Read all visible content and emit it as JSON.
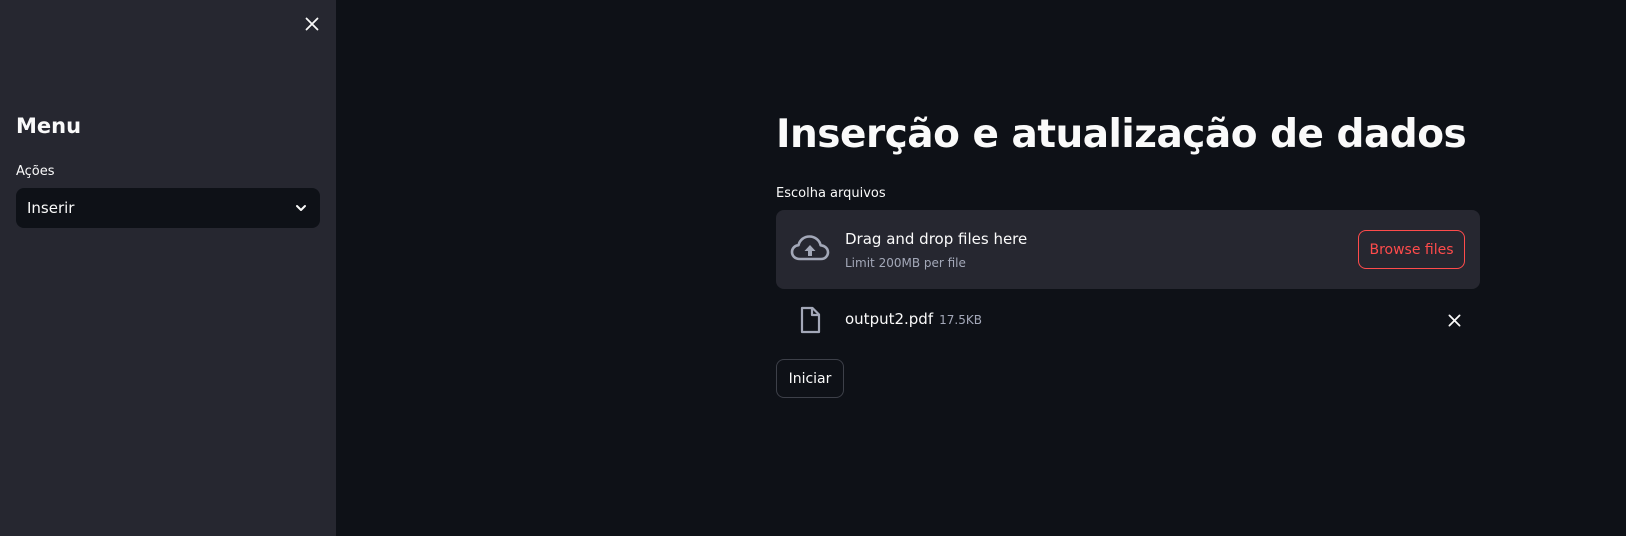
{
  "sidebar": {
    "close_icon": "close-icon",
    "title": "Menu",
    "select": {
      "label": "Ações",
      "value": "Inserir",
      "icon": "chevron-down-icon"
    }
  },
  "main": {
    "title": "Inserção e atualização de dados",
    "uploader": {
      "label": "Escolha arquivos",
      "icon": "cloud-upload-icon",
      "dropzone_title": "Drag and drop files here",
      "dropzone_limit": "Limit 200MB per file",
      "browse_label": "Browse files"
    },
    "files": [
      {
        "name": "output2.pdf",
        "size": "17.5KB",
        "icon": "file-icon",
        "remove_icon": "close-icon"
      }
    ],
    "start_button": "Iniciar"
  },
  "colors": {
    "background": "#0e1117",
    "sidebar": "#262730",
    "accent": "#ff4b4b",
    "text": "#fafafa",
    "muted": "#a3a8b8"
  }
}
